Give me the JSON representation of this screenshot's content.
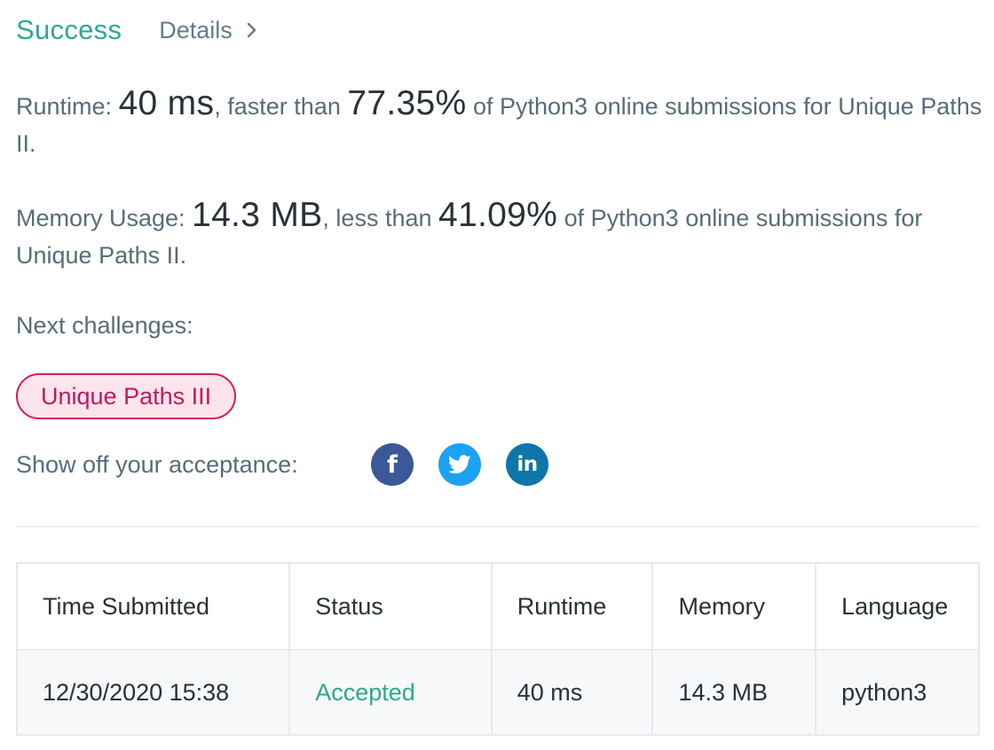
{
  "header": {
    "status": "Success",
    "details_label": "Details",
    "details_icon": "chevron-right-icon"
  },
  "runtime": {
    "label": "Runtime:",
    "value": "40 ms",
    "comparison": ", faster than",
    "percent": "77.35%",
    "suffix": "of Python3 online submissions for Unique Paths II."
  },
  "memory": {
    "label": "Memory Usage:",
    "value": "14.3 MB",
    "comparison": ", less than",
    "percent": "41.09%",
    "suffix": "of Python3 online submissions for Unique Paths II."
  },
  "next_challenges": {
    "label": "Next challenges:",
    "items": [
      {
        "label": "Unique Paths III"
      }
    ]
  },
  "share": {
    "label": "Show off your acceptance:",
    "icons": [
      "facebook-icon",
      "twitter-icon",
      "linkedin-icon"
    ]
  },
  "submissions_table": {
    "columns": [
      "Time Submitted",
      "Status",
      "Runtime",
      "Memory",
      "Language"
    ],
    "rows": [
      {
        "time": "12/30/2020 15:38",
        "status": "Accepted",
        "runtime": "40 ms",
        "memory": "14.3 MB",
        "language": "python3"
      }
    ]
  },
  "colors": {
    "accent_green": "#2ea891",
    "text_body": "#546e7a",
    "text_strong": "#263238",
    "pill_border": "#d81b60",
    "pill_bg": "#fce4ec",
    "facebook": "#3b5998",
    "twitter": "#1da1f2",
    "linkedin": "#0e76a8"
  }
}
